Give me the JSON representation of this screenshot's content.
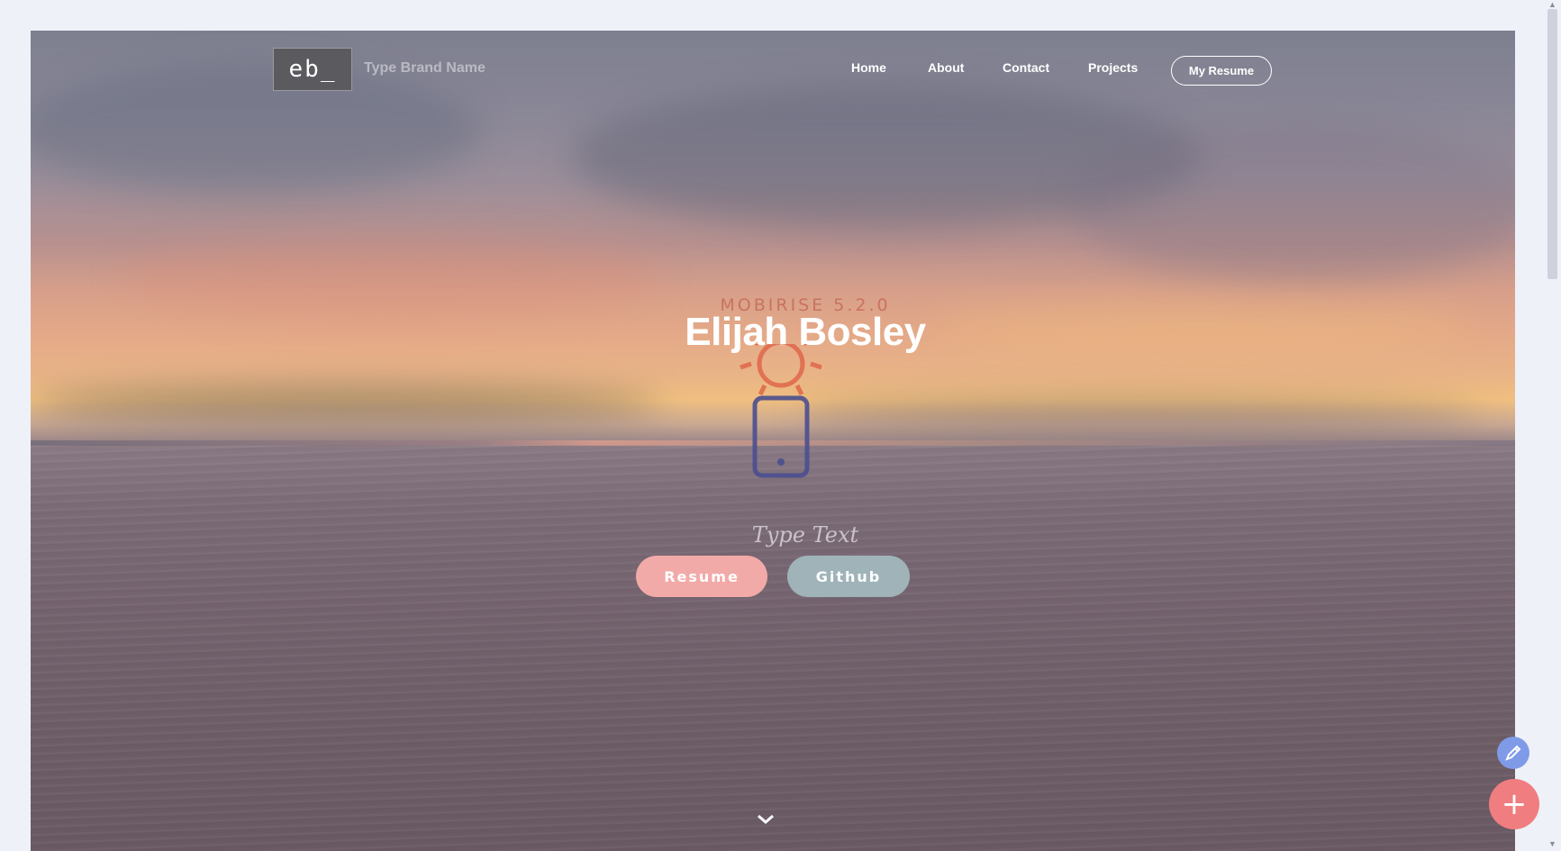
{
  "header": {
    "logo_text": "eb_",
    "brand_name": "Type Brand Name",
    "nav": [
      {
        "label": "Home"
      },
      {
        "label": "About"
      },
      {
        "label": "Contact"
      },
      {
        "label": "Projects"
      }
    ],
    "resume_button": "My Resume"
  },
  "hero": {
    "overlay_text": "MOBIRISE 5.2.0",
    "title": "Elijah Bosley",
    "subtitle": "Type Text",
    "buttons": [
      {
        "label": "Resume",
        "color": "#f2aaa8"
      },
      {
        "label": "Github",
        "color": "#9fb3b9"
      }
    ],
    "graphic_icons": [
      "sun-icon",
      "phone-icon"
    ],
    "colors": {
      "sun": "#e0674a",
      "phone": "#4b4f8f"
    }
  },
  "floating_actions": {
    "edit_icon": "pencil-icon",
    "add_icon": "plus-icon",
    "add_glyph": "+"
  }
}
